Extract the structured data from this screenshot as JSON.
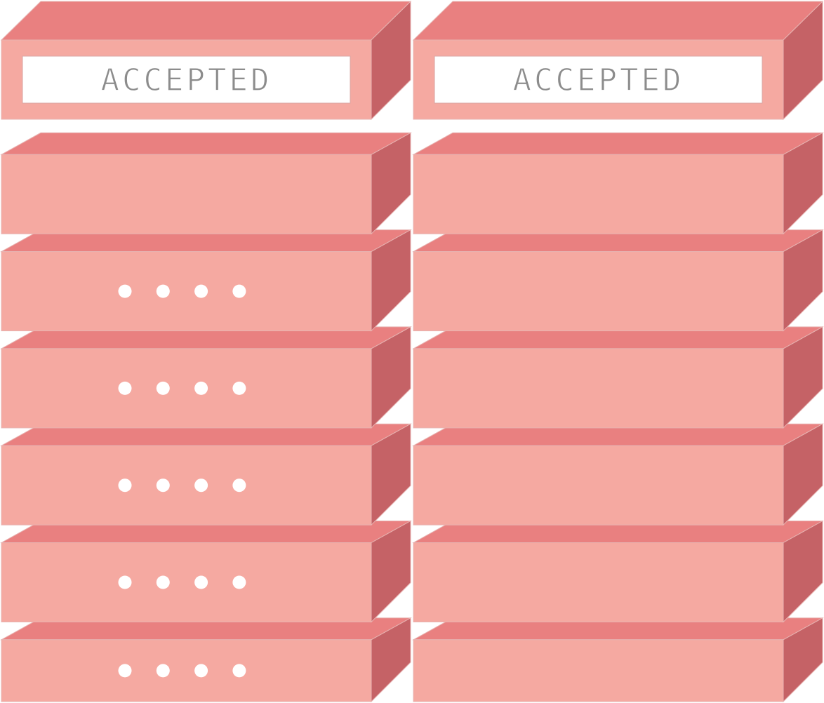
{
  "colors": {
    "front": "#f5a9a1",
    "top": "#e98080",
    "side": "#c56266",
    "edge": "#e7b3b1",
    "label_bg": "#ffffff",
    "label_text": "#8c8c8c",
    "dot": "#ffffff"
  },
  "stacks": [
    {
      "label": "ACCEPTED",
      "blocks": [
        {
          "kind": "label"
        },
        {
          "kind": "plain",
          "dots": 0
        },
        {
          "kind": "dots",
          "dots": 4
        },
        {
          "kind": "dots",
          "dots": 4
        },
        {
          "kind": "dots",
          "dots": 4
        },
        {
          "kind": "dots",
          "dots": 4
        },
        {
          "kind": "dots",
          "dots": 4
        }
      ]
    },
    {
      "label": "ACCEPTED",
      "blocks": [
        {
          "kind": "label"
        },
        {
          "kind": "plain",
          "dots": 0
        },
        {
          "kind": "plain",
          "dots": 0
        },
        {
          "kind": "plain",
          "dots": 0
        },
        {
          "kind": "plain",
          "dots": 0
        },
        {
          "kind": "plain",
          "dots": 0
        },
        {
          "kind": "plain",
          "dots": 0
        }
      ]
    }
  ]
}
